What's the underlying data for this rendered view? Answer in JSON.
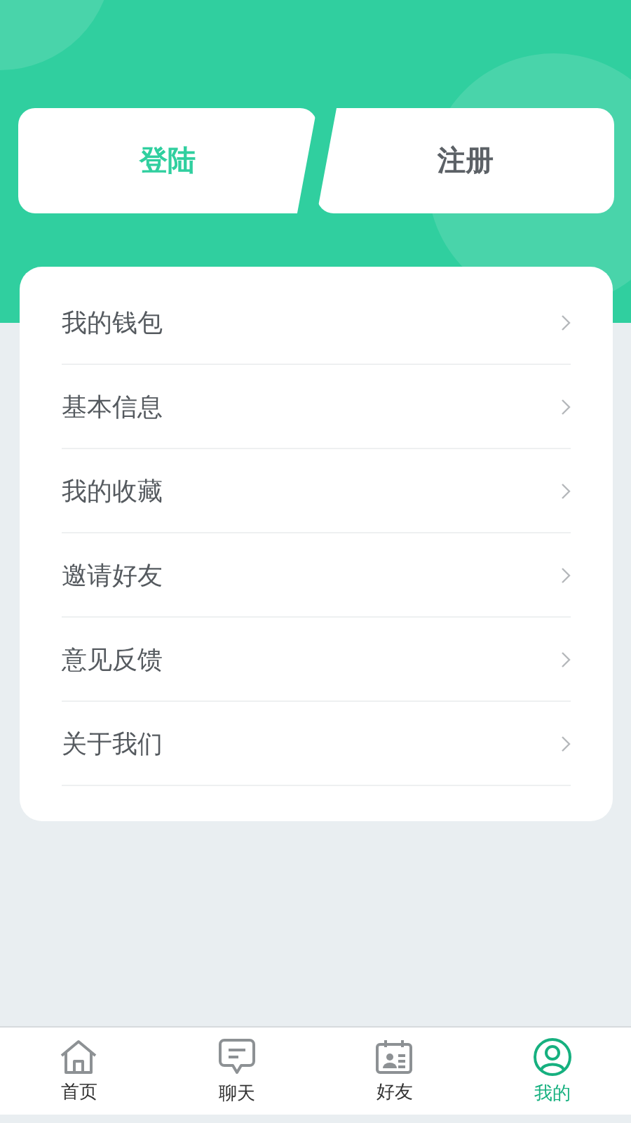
{
  "auth_buttons": [
    {
      "label": "登陆",
      "selected": true
    },
    {
      "label": "注册",
      "selected": false
    }
  ],
  "menu": [
    {
      "label": "我的钱包"
    },
    {
      "label": "基本信息"
    },
    {
      "label": "我的收藏"
    },
    {
      "label": "邀请好友"
    },
    {
      "label": "意见反馈"
    },
    {
      "label": "关于我们"
    }
  ],
  "tab_bar": [
    {
      "label": "首页",
      "selected": false
    },
    {
      "label": "聊天",
      "selected": false
    },
    {
      "label": "好友",
      "selected": false
    },
    {
      "label": "我的",
      "selected": true
    }
  ]
}
